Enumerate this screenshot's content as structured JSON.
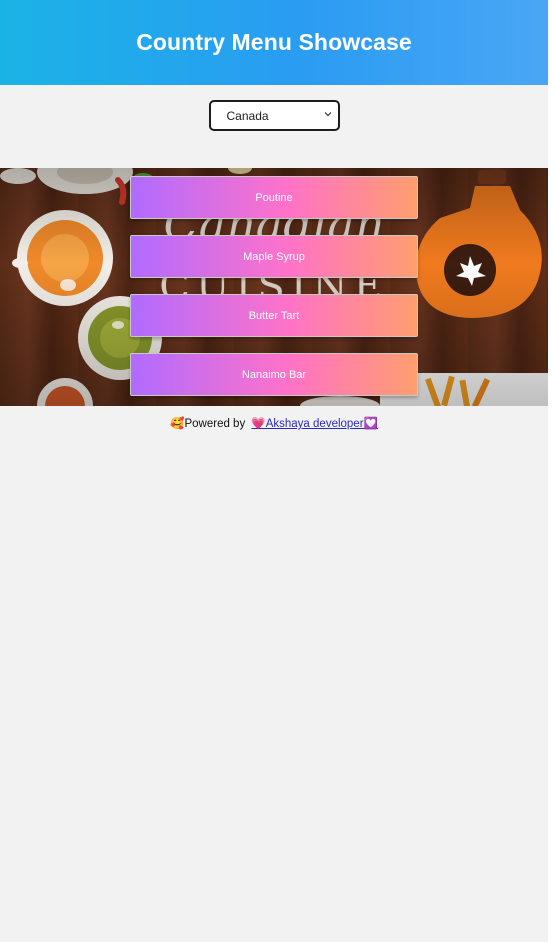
{
  "header": {
    "title": "Country Menu Showcase"
  },
  "country_select": {
    "value": "Canada"
  },
  "menu": {
    "items": [
      {
        "label": "Poutine"
      },
      {
        "label": "Maple Syrup"
      },
      {
        "label": "Butter Tart"
      },
      {
        "label": "Nanaimo Bar"
      }
    ]
  },
  "footer": {
    "prefix_emoji": "🥰",
    "prefix": "Powered by",
    "link_text": "💗Akshaya developer💟"
  },
  "colors": {
    "header_start": "#1bb3e6",
    "header_end": "#4aa6f5",
    "button_start": "#b06bff",
    "button_mid": "#ff72c8",
    "button_end": "#ff9e6e",
    "link": "#2b2bbf"
  }
}
